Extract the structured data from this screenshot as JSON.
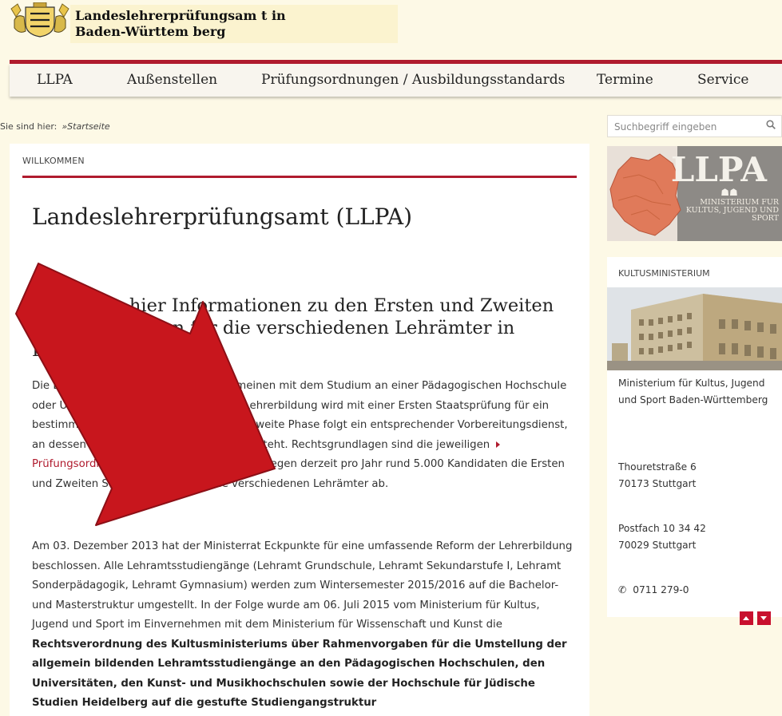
{
  "header": {
    "site_name_line1": "Landeslehrerprüfungsam t in",
    "site_name_line2": "Baden-Württem berg"
  },
  "nav": {
    "items": [
      "LLPA",
      "Außenstellen",
      "Prüfungsordnungen / Ausbildungsstandards",
      "Termine",
      "Service"
    ]
  },
  "breadcrumb": {
    "prefix": "Sie sind hier:",
    "current": "»Startseite"
  },
  "search": {
    "placeholder": "Suchbegriff eingeben",
    "icon": "search-icon"
  },
  "main": {
    "section_label": "WILLKOMMEN",
    "title": "Landeslehrerprüfungsamt (LLPA)",
    "subtitle": "Sie finden hier Informationen zu den Ersten und Zweiten Staatsprüfungen für die verschiedenen Lehrämter in Baden-Württemberg.",
    "p1_part1": "Die Lehrerausbildung beginnt im Allgemeinen mit dem Studium an einer Pädagogischen Hochschule oder Universität. Diese erste Phase der Lehrerbildung wird mit einer Ersten Staatsprüfung für ein bestimmtes Lehramt abgeschlossen. Als zweite Phase folgt ein entsprechender Vorbereitungsdienst, an dessen Ende die Zweite Staatsprüfung steht. Rechtsgrundlagen sind die jeweiligen",
    "p1_link": "Prüfungsordnungen",
    "p1_part2": ". In Baden-Württemberg legen derzeit pro Jahr rund 5.000 Kandidaten die Ersten und Zweiten Staatsprüfungen für die verschiedenen Lehrämter ab.",
    "p2_part1": "Am 03. Dezember 2013 hat der Ministerrat Eckpunkte für eine umfassende Reform der Lehrerbildung beschlossen. Alle Lehramtsstudiengänge (Lehramt Grundschule, Lehramt Sekundarstufe I, Lehramt Sonderpädagogik, Lehramt Gymnasium) werden zum Wintersemester 2015/2016 auf die Bachelor- und Masterstruktur umgestellt. In der Folge wurde am 06. Juli 2015 vom Ministerium für Kultus, Jugend und Sport im Einvernehmen mit dem Ministerium für Wissenschaft und Kunst die",
    "p2_bold": "Rechtsverordnung des Kultusministeriums über Rahmenvorgaben für die Umstellung der allgemein bildenden Lehramtsstudiengänge an den Pädagogischen Hochschulen, den Universitäten, den Kunst- und Musikhochschulen sowie der Hochschule für Jüdische Studien Heidelberg auf die gestufte Studiengangstruktur"
  },
  "sidebar": {
    "banner_big": "LLPA",
    "banner_small": "MINISTERIUM FÜR KULTUS, JUGEND UND SPORT",
    "kultus_label": "KULTUSMINISTERIUM",
    "ministry_name": "Ministerium für Kultus, Jugend und Sport Baden-Württemberg",
    "street": "Thouretstraße 6",
    "city1": "70173 Stuttgart",
    "postbox": "Postfach 10 34 42",
    "city2": "70029 Stuttgart",
    "phone": "0711 279-0"
  },
  "colors": {
    "accent": "#b01b2e",
    "background": "#fdf9e6",
    "annotation_arrow": "#c8161d"
  }
}
